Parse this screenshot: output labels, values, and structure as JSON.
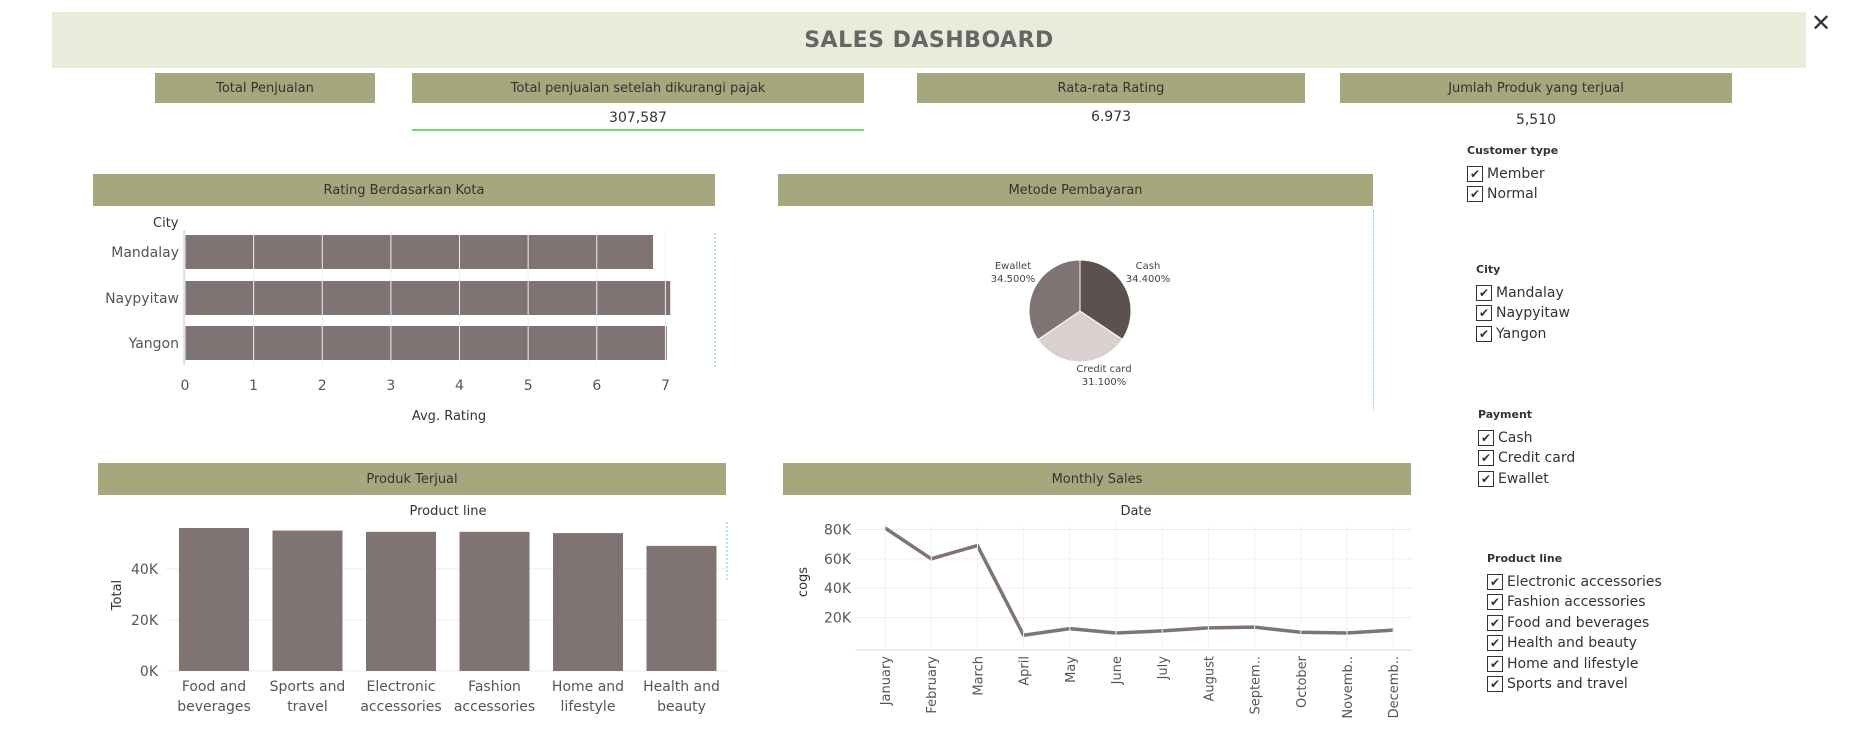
{
  "title": "SALES DASHBOARD",
  "close_icon": "close-icon",
  "kpis": [
    {
      "label": "Total Penjualan",
      "value": ""
    },
    {
      "label": "Total penjualan setelah dikurangi pajak",
      "value": "307,587"
    },
    {
      "label": "Rata-rata Rating",
      "value": "6.973"
    },
    {
      "label": "Jumlah Produk yang terjual",
      "value": "5,510"
    }
  ],
  "rating_panel": {
    "title": "Rating Berdasarkan Kota",
    "chart_data": {
      "type": "bar",
      "orientation": "horizontal",
      "header": "City",
      "categories": [
        "Mandalay",
        "Naypyitaw",
        "Yangon"
      ],
      "values": [
        6.82,
        7.07,
        7.02
      ],
      "xlabel": "Avg. Rating",
      "xticks": [
        "0",
        "1",
        "2",
        "3",
        "4",
        "5",
        "6",
        "7"
      ],
      "xlim": [
        0,
        7.3
      ],
      "color": "#7f7473"
    }
  },
  "payment_panel": {
    "title": "Metode Pembayaran",
    "chart_data": {
      "type": "pie",
      "slices": [
        {
          "label": "Cash",
          "pct_label": "34.400%",
          "value": 34.4,
          "color": "#5c514f"
        },
        {
          "label": "Credit card",
          "pct_label": "31.100%",
          "value": 31.1,
          "color": "#d9d1cf"
        },
        {
          "label": "Ewallet",
          "pct_label": "34.500%",
          "value": 34.5,
          "color": "#7f7473"
        }
      ]
    }
  },
  "product_panel": {
    "title": "Produk Terjual",
    "chart_data": {
      "type": "bar",
      "header": "Product line",
      "categories": [
        [
          "Food and",
          "beverages"
        ],
        [
          "Sports and",
          "travel"
        ],
        [
          "Electronic",
          "accessories"
        ],
        [
          "Fashion",
          "accessories"
        ],
        [
          "Home and",
          "lifestyle"
        ],
        [
          "Health and",
          "beauty"
        ]
      ],
      "values": [
        56000,
        55000,
        54500,
        54500,
        54000,
        49000
      ],
      "ylabel": "Total",
      "yticks": [
        {
          "v": 0,
          "t": "0K"
        },
        {
          "v": 20000,
          "t": "20K"
        },
        {
          "v": 40000,
          "t": "40K"
        }
      ],
      "ylim": [
        0,
        56000
      ],
      "color": "#7f7473"
    }
  },
  "monthly_panel": {
    "title": "Monthly Sales",
    "chart_data": {
      "type": "line",
      "header": "Date",
      "x": [
        "January",
        "February",
        "March",
        "April",
        "May",
        "June",
        "July",
        "August",
        "Septem..",
        "October",
        "Novemb..",
        "Decemb.."
      ],
      "values": [
        81000,
        60000,
        69000,
        8000,
        12500,
        9500,
        11000,
        13000,
        13500,
        10000,
        9500,
        11500
      ],
      "ylabel": "cogs",
      "yticks": [
        {
          "v": 20000,
          "t": "20K"
        },
        {
          "v": 40000,
          "t": "40K"
        },
        {
          "v": 60000,
          "t": "60K"
        },
        {
          "v": 80000,
          "t": "80K"
        }
      ],
      "ylim": [
        0,
        83000
      ],
      "grid": true,
      "color": "#7f7473"
    }
  },
  "filters": [
    {
      "title": "Customer type",
      "items": [
        "Member",
        "Normal"
      ]
    },
    {
      "title": "City",
      "items": [
        "Mandalay",
        "Naypyitaw",
        "Yangon"
      ]
    },
    {
      "title": "Payment",
      "items": [
        "Cash",
        "Credit card",
        "Ewallet"
      ]
    },
    {
      "title": "Product line",
      "items": [
        "Electronic accessories",
        "Fashion accessories",
        "Food and beverages",
        "Health and beauty",
        "Home and lifestyle",
        "Sports and travel"
      ]
    }
  ],
  "check_mark": "✔"
}
